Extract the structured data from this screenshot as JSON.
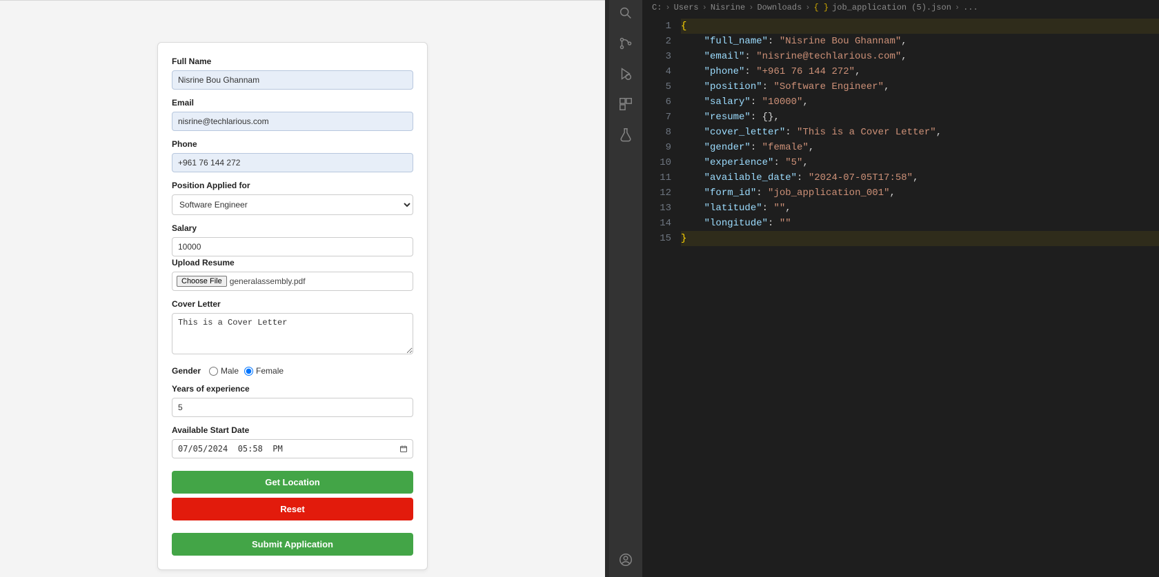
{
  "form": {
    "labels": {
      "full_name": "Full Name",
      "email": "Email",
      "phone": "Phone",
      "position": "Position Applied for",
      "salary": "Salary",
      "upload_resume": "Upload Resume",
      "cover_letter": "Cover Letter",
      "gender": "Gender",
      "male": "Male",
      "female": "Female",
      "years_exp": "Years of experience",
      "avail_date": "Available Start Date",
      "choose_file": "Choose File"
    },
    "values": {
      "full_name": "Nisrine Bou Ghannam",
      "email": "nisrine@techlarious.com",
      "phone": "+961 76 144 272",
      "position": "Software Engineer",
      "salary": "10000",
      "resume_filename": "generalassembly.pdf",
      "cover_letter": "This is a Cover Letter",
      "years_exp": "5",
      "avail_date_display": "07/05/2024  05:58  PM"
    },
    "gender_selected": "female",
    "buttons": {
      "get_location": "Get Location",
      "reset": "Reset",
      "submit": "Submit Application"
    }
  },
  "editor": {
    "breadcrumb": [
      "C:",
      "Users",
      "Nisrine",
      "Downloads",
      "job_application (5).json",
      "..."
    ],
    "file_icon_name": "json-braces-icon",
    "lines": [
      {
        "n": 1,
        "raw": "{"
      },
      {
        "n": 2,
        "key": "full_name",
        "val": "Nisrine Bou Ghannam",
        "type": "str",
        "comma": true
      },
      {
        "n": 3,
        "key": "email",
        "val": "nisrine@techlarious.com",
        "type": "str",
        "comma": true
      },
      {
        "n": 4,
        "key": "phone",
        "val": "+961 76 144 272",
        "type": "str",
        "comma": true
      },
      {
        "n": 5,
        "key": "position",
        "val": "Software Engineer",
        "type": "str",
        "comma": true
      },
      {
        "n": 6,
        "key": "salary",
        "val": "10000",
        "type": "str",
        "comma": true
      },
      {
        "n": 7,
        "key": "resume",
        "val": "{}",
        "type": "obj",
        "comma": true
      },
      {
        "n": 8,
        "key": "cover_letter",
        "val": "This is a Cover Letter",
        "type": "str",
        "comma": true
      },
      {
        "n": 9,
        "key": "gender",
        "val": "female",
        "type": "str",
        "comma": true
      },
      {
        "n": 10,
        "key": "experience",
        "val": "5",
        "type": "str",
        "comma": true
      },
      {
        "n": 11,
        "key": "available_date",
        "val": "2024-07-05T17:58",
        "type": "str",
        "comma": true
      },
      {
        "n": 12,
        "key": "form_id",
        "val": "job_application_001",
        "type": "str",
        "comma": true
      },
      {
        "n": 13,
        "key": "latitude",
        "val": "",
        "type": "str",
        "comma": true
      },
      {
        "n": 14,
        "key": "longitude",
        "val": "",
        "type": "str",
        "comma": false
      },
      {
        "n": 15,
        "raw": "}"
      }
    ]
  }
}
